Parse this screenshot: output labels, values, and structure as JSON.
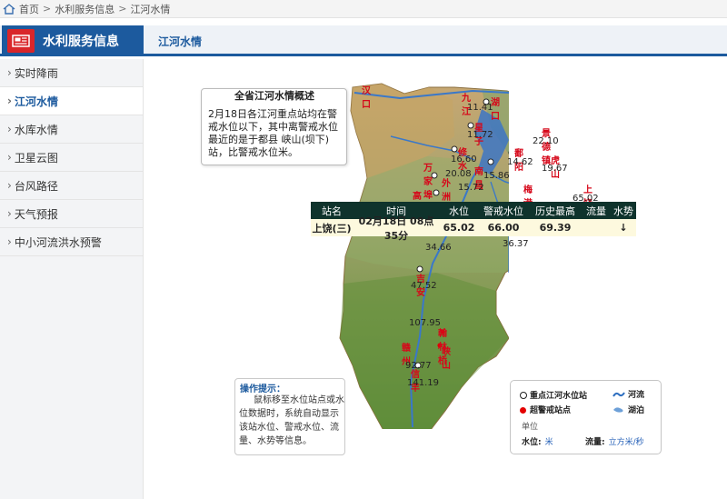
{
  "breadcrumb": {
    "home": "首页",
    "sep": ">",
    "level1": "水利服务信息",
    "level2": "江河水情"
  },
  "module": {
    "title": "水利服务信息"
  },
  "page": {
    "title": "江河水情"
  },
  "sidebar": {
    "items": [
      {
        "label": "实时降雨"
      },
      {
        "label": "江河水情"
      },
      {
        "label": "水库水情"
      },
      {
        "label": "卫星云图"
      },
      {
        "label": "台风路径"
      },
      {
        "label": "天气预报"
      },
      {
        "label": "中小河流洪水预警"
      }
    ]
  },
  "overview": {
    "title": "全省江河水情概述",
    "text": "2月18日各江河重点站均在警戒水位以下，其中离警戒水位最近的是于都县 峡山(坝下)站，比警戒水位米。"
  },
  "popup": {
    "headers": [
      "站名",
      "时间",
      "水位",
      "警戒水位",
      "历史最高",
      "流量",
      "水势"
    ],
    "row": {
      "station": "上饶(三)",
      "time": "02月18日 08点35分",
      "level": "65.02",
      "warning": "66.00",
      "history": "69.39",
      "flow": "",
      "trend": "↓"
    }
  },
  "tips": {
    "title": "操作提示：",
    "text": "鼠标移至水位站点或水位数据时，系统自动显示该站水位、警戒水位、流量、水势等信息。"
  },
  "legend": {
    "key_station": "重点江河水位站",
    "over_warning": "超警戒站点",
    "river": "河流",
    "lake": "湖泊",
    "unit_label": "单位",
    "level_label": "水位:",
    "level_unit": "米",
    "flow_label": "流量:",
    "flow_unit": "立方米/秒"
  },
  "map": {
    "places": [
      "汉口",
      "九江",
      "湖口",
      "星子",
      "景德镇",
      "修水",
      "南昌",
      "樟树",
      "鄱阳",
      "万家埠",
      "外洲",
      "梅港",
      "上饶",
      "高安",
      "吉安",
      "峡江",
      "赣州",
      "宁都",
      "翰林桥",
      "峡山",
      "信丰",
      "龙口",
      "虎山",
      "石镇"
    ],
    "readings": [
      "11.41",
      "11.72",
      "22.10",
      "16.60",
      "15.86",
      "14.62",
      "19.67",
      "20.08",
      "15.72",
      "65.02",
      "34.66",
      "36.37",
      "47.52",
      "107.95",
      "92.77",
      "141.19"
    ]
  }
}
